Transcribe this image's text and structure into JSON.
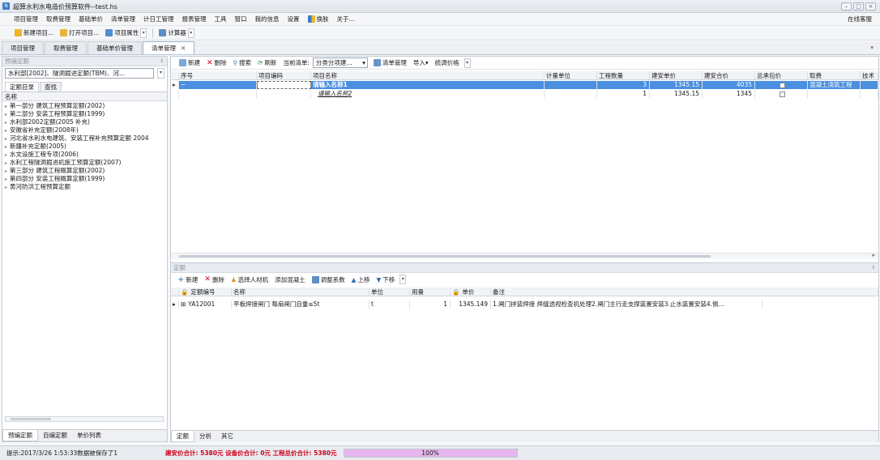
{
  "window": {
    "title": "超算水利水电造价预算软件--test.hs",
    "app_icon": "N",
    "controls": [
      "–",
      "□",
      "×"
    ]
  },
  "menu": {
    "items": [
      "项目管理",
      "取费管理",
      "基础单价",
      "清单管理",
      "计日工管理",
      "报表管理",
      "工具",
      "窗口",
      "我的信息",
      "设置",
      "换肤",
      "关于..."
    ],
    "right": "在线客服"
  },
  "toolbar": {
    "new_project": "新建项目...",
    "open_project": "打开项目...",
    "project_props": "项目属性",
    "calculator": "计算器"
  },
  "doc_tabs": [
    {
      "label": "项目管理"
    },
    {
      "label": "取费管理"
    },
    {
      "label": "基础单价管理"
    },
    {
      "label": "清单管理"
    }
  ],
  "left": {
    "header": "预编定额",
    "pin": "⇕",
    "combo_value": "水利部[2002]、隧洞掘进定额(TBM)、河...",
    "subtabs": [
      "定额目录",
      "查找"
    ],
    "tree_header": "名称",
    "tree": [
      "第一部分 建筑工程预算定额(2002)",
      "第二部分 安装工程预算定额(1999)",
      "水利部2002定额(2005 补充)",
      "安徽省补充定额(2008年)",
      "河北省水利水电建筑、安装工程补充预算定额 2004",
      "新疆补充定额(2005)",
      "水文设施工程专项(2006)",
      "水利工程隧洞掘进机施工预算定额(2007)",
      "第三部分 建筑工程概算定额(2002)",
      "第四部分 安装工程概算定额(1999)",
      "黄河防洪工程预算定额"
    ],
    "bottom_tabs": [
      "预编定额",
      "自编定额",
      "单价列表"
    ]
  },
  "list_toolbar": {
    "new": "新建",
    "delete": "删除",
    "search": "搜索",
    "refresh": "刷新",
    "current_list_label": "当前清单:",
    "current_list_value": "分类分项建...",
    "list_manage": "清单管理",
    "import": "导入",
    "unify_price": "统调价格"
  },
  "list_grid": {
    "headers": [
      "序号",
      "项目编码",
      "项目名称",
      "计量单位",
      "工程数量",
      "建安单价",
      "建安合价",
      "总承包价",
      "取费",
      "技术"
    ],
    "rows": [
      {
        "seq": "",
        "code": "",
        "name": "请输入名称1",
        "unit": "",
        "qty": "3",
        "unit_price": "1345.15",
        "total": "4035",
        "fee": "混凝土浇筑工程"
      },
      {
        "seq": "",
        "code": "",
        "name": "请输入名称2",
        "unit": "",
        "qty": "1",
        "unit_price": "1345.15",
        "total": "1345",
        "fee": ""
      }
    ]
  },
  "quota": {
    "header": "定额",
    "pin": "⇕",
    "toolbar": {
      "new": "新建",
      "delete": "删除",
      "select_materials": "选择人材机",
      "add_concrete": "添加混凝土",
      "adjust_coef": "调整系数",
      "move_up": "上移",
      "move_down": "下移"
    },
    "headers": [
      "定额编号",
      "名称",
      "单位",
      "用量",
      "单价",
      "备注"
    ],
    "rows": [
      {
        "code": "YA12001",
        "name": "平板焊接闸门 每扇闸门自重≤5t",
        "unit": "t",
        "qty": "1",
        "price": "1345.149",
        "note": "1.闸门拼装焊接 焊缝透视检查机处理2.闸门主行走支撑装置安装3.止水装置安装4.侧..."
      }
    ],
    "bottom_tabs": [
      "定额",
      "分析",
      "其它"
    ]
  },
  "status": {
    "saved": "提示:2017/3/26 1:53:33数据被保存了1",
    "totals": "建安价合计: 5380元 设备价合计: 0元 工程总价合计: 5380元",
    "progress": 100,
    "progress_label": "100%"
  },
  "colors": {
    "accent": "#3d7bc8",
    "selected_row": "#4a8fe0",
    "status_red": "#d0021b",
    "progress": "#e6b6ee"
  }
}
